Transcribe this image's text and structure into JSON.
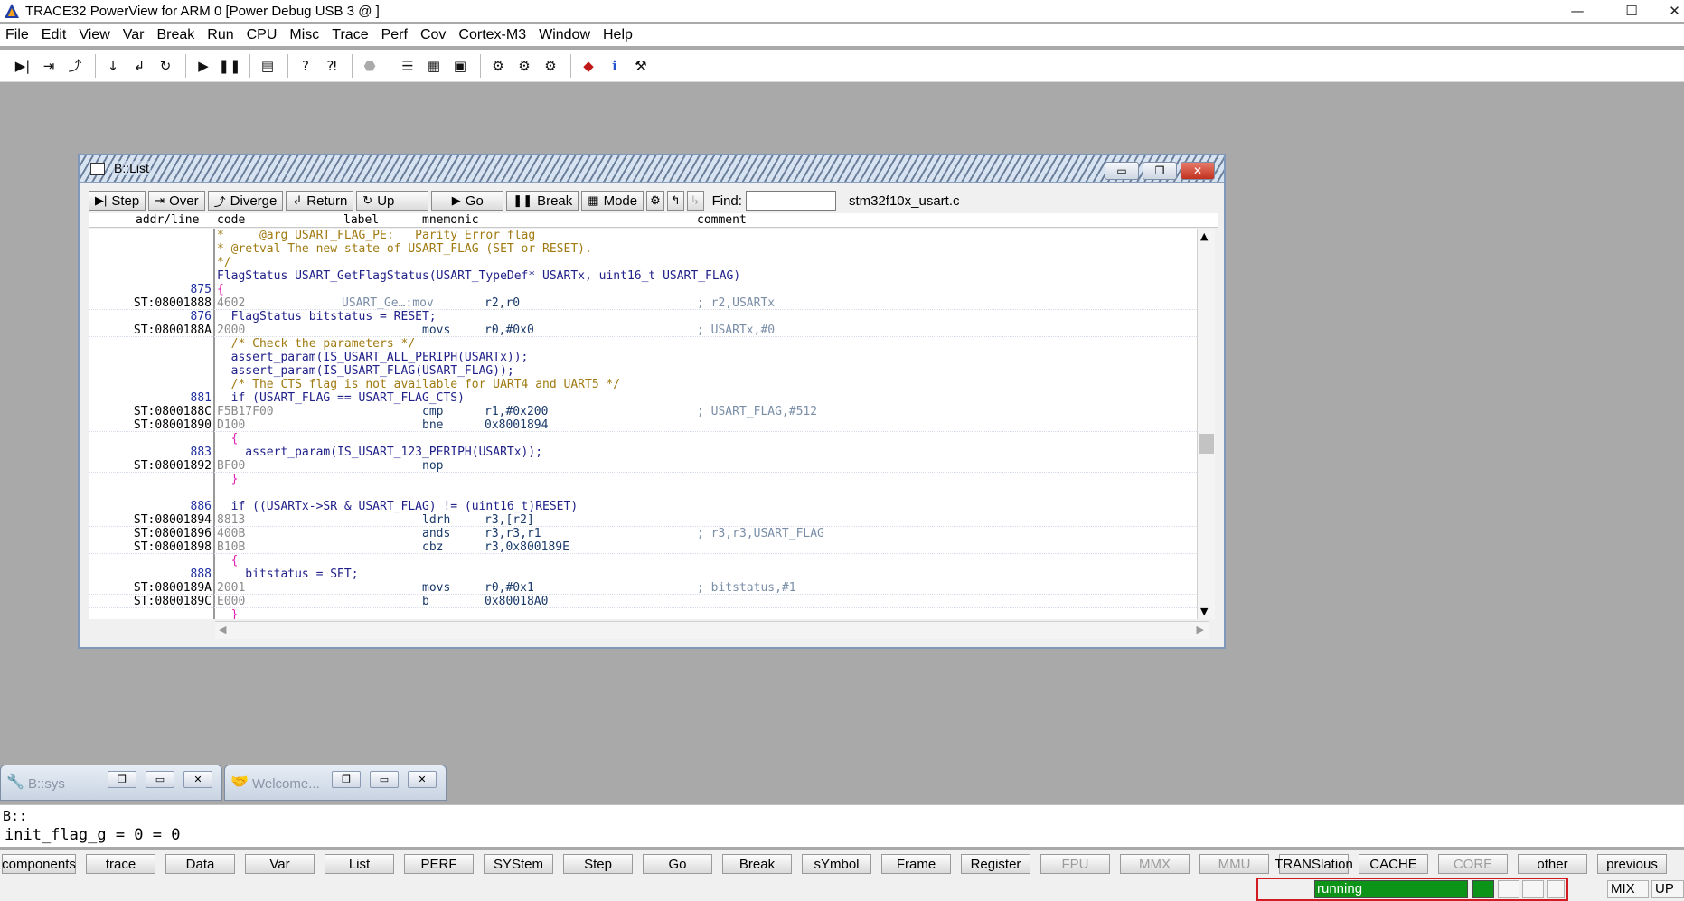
{
  "app": {
    "title": "TRACE32 PowerView for ARM 0 [Power Debug USB 3 @ ]",
    "minimize": "—",
    "maximize": "☐",
    "close": "✕"
  },
  "menu": [
    "File",
    "Edit",
    "View",
    "Var",
    "Break",
    "Run",
    "CPU",
    "Misc",
    "Trace",
    "Perf",
    "Cov",
    "Cortex-M3",
    "Window",
    "Help"
  ],
  "toolbar_icons": [
    "step-icon",
    "step-over-icon",
    "diverge-icon",
    "down-icon",
    "return-icon",
    "up-icon",
    "go-icon",
    "break-icon",
    "list-icon",
    "help-icon",
    "context-help-icon",
    "stop-icon",
    "list-view-icon",
    "dump-icon",
    "chip-icon",
    "trace-icon",
    "perf-icon",
    "cov-icon",
    "cube-icon",
    "info-icon",
    "config-icon"
  ],
  "blist": {
    "title": "B::List",
    "tools": {
      "step": "Step",
      "over": "Over",
      "diverge": "Diverge",
      "return": "Return",
      "up": "Up",
      "go": "Go",
      "break": "Break",
      "mode": "Mode",
      "find_label": "Find:",
      "file": "stm32f10x_usart.c"
    },
    "headers": {
      "addr": "addr/line",
      "code": "code",
      "label": "label",
      "mnemonic": "mnemonic",
      "comment": "comment"
    },
    "rows": [
      {
        "kind": "src",
        "addr": "",
        "text": "*     @arg USART_FLAG_PE:   Parity Error flag",
        "style": "comment"
      },
      {
        "kind": "src",
        "addr": "",
        "text": "* @retval The new state of USART_FLAG (SET or RESET).",
        "style": "comment"
      },
      {
        "kind": "src",
        "addr": "",
        "text": "*/",
        "style": "comment"
      },
      {
        "kind": "src",
        "addr": "",
        "text": "FlagStatus USART_GetFlagStatus(USART_TypeDef* USARTx, uint16_t USART_FLAG)",
        "style": "stmt"
      },
      {
        "kind": "src",
        "addr": "875",
        "text": "{",
        "style": "brace"
      },
      {
        "kind": "asm",
        "addr": "ST:08001888",
        "code": "4602",
        "label": "USART_Ge…:mov",
        "mnem": "",
        "ops": "r2,r0",
        "cmt": "; r2,USARTx"
      },
      {
        "kind": "src",
        "addr": "876",
        "text": "  FlagStatus bitstatus = RESET;",
        "style": "stmt"
      },
      {
        "kind": "asm",
        "addr": "ST:0800188A",
        "code": "2000",
        "label": "",
        "mnem": "movs",
        "ops": "r0,#0x0",
        "cmt": "; USARTx,#0"
      },
      {
        "kind": "src",
        "addr": "",
        "text": "  /* Check the parameters */",
        "style": "comment"
      },
      {
        "kind": "src",
        "addr": "",
        "text": "  assert_param(IS_USART_ALL_PERIPH(USARTx));",
        "style": "stmt"
      },
      {
        "kind": "src",
        "addr": "",
        "text": "  assert_param(IS_USART_FLAG(USART_FLAG));",
        "style": "stmt"
      },
      {
        "kind": "src",
        "addr": "",
        "text": "  /* The CTS flag is not available for UART4 and UART5 */",
        "style": "comment"
      },
      {
        "kind": "src",
        "addr": "881",
        "text": "  if (USART_FLAG == USART_FLAG_CTS)",
        "style": "stmt"
      },
      {
        "kind": "asm",
        "addr": "ST:0800188C",
        "code": "F5B17F00",
        "label": "",
        "mnem": "cmp",
        "ops": "r1,#0x200",
        "cmt": "; USART_FLAG,#512"
      },
      {
        "kind": "asm",
        "addr": "ST:08001890",
        "code": "D100",
        "label": "",
        "mnem": "bne",
        "ops": "0x8001894",
        "cmt": ""
      },
      {
        "kind": "src",
        "addr": "",
        "text": "  {",
        "style": "brace"
      },
      {
        "kind": "src",
        "addr": "883",
        "text": "    assert_param(IS_USART_123_PERIPH(USARTx));",
        "style": "stmt"
      },
      {
        "kind": "asm",
        "addr": "ST:08001892",
        "code": "BF00",
        "label": "",
        "mnem": "nop",
        "ops": "",
        "cmt": ""
      },
      {
        "kind": "src",
        "addr": "",
        "text": "  }",
        "style": "brace"
      },
      {
        "kind": "src",
        "addr": "",
        "text": "",
        "style": "stmt"
      },
      {
        "kind": "src",
        "addr": "886",
        "text": "  if ((USARTx->SR & USART_FLAG) != (uint16_t)RESET)",
        "style": "stmt"
      },
      {
        "kind": "asm",
        "addr": "ST:08001894",
        "code": "8813",
        "label": "",
        "mnem": "ldrh",
        "ops": "r3,[r2]",
        "cmt": ""
      },
      {
        "kind": "asm",
        "addr": "ST:08001896",
        "code": "400B",
        "label": "",
        "mnem": "ands",
        "ops": "r3,r3,r1",
        "cmt": "; r3,r3,USART_FLAG"
      },
      {
        "kind": "asm",
        "addr": "ST:08001898",
        "code": "B10B",
        "label": "",
        "mnem": "cbz",
        "ops": "r3,0x800189E",
        "cmt": ""
      },
      {
        "kind": "src",
        "addr": "",
        "text": "  {",
        "style": "brace"
      },
      {
        "kind": "src",
        "addr": "888",
        "text": "    bitstatus = SET;",
        "style": "stmt"
      },
      {
        "kind": "asm",
        "addr": "ST:0800189A",
        "code": "2001",
        "label": "",
        "mnem": "movs",
        "ops": "r0,#0x1",
        "cmt": "; bitstatus,#1"
      },
      {
        "kind": "asm",
        "addr": "ST:0800189C",
        "code": "E000",
        "label": "",
        "mnem": "b",
        "ops": "0x80018A0",
        "cmt": ""
      },
      {
        "kind": "src",
        "addr": "",
        "text": "  }",
        "style": "brace"
      }
    ]
  },
  "minimized": [
    {
      "label": "B::sys"
    },
    {
      "label": "Welcome..."
    }
  ],
  "command": {
    "prompt": "B::",
    "result": "init_flag_g = 0 = 0"
  },
  "buttons": [
    {
      "label": "components",
      "disabled": false,
      "w": 80
    },
    {
      "label": "trace",
      "disabled": false,
      "w": 76
    },
    {
      "label": "Data",
      "disabled": false,
      "w": 76
    },
    {
      "label": "Var",
      "disabled": false,
      "w": 76
    },
    {
      "label": "List",
      "disabled": false,
      "w": 76
    },
    {
      "label": "PERF",
      "disabled": false,
      "w": 76
    },
    {
      "label": "SYStem",
      "disabled": false,
      "w": 76
    },
    {
      "label": "Step",
      "disabled": false,
      "w": 76
    },
    {
      "label": "Go",
      "disabled": false,
      "w": 76
    },
    {
      "label": "Break",
      "disabled": false,
      "w": 76
    },
    {
      "label": "sYmbol",
      "disabled": false,
      "w": 76
    },
    {
      "label": "Frame",
      "disabled": false,
      "w": 76
    },
    {
      "label": "Register",
      "disabled": false,
      "w": 76
    },
    {
      "label": "FPU",
      "disabled": true,
      "w": 76
    },
    {
      "label": "MMX",
      "disabled": true,
      "w": 76
    },
    {
      "label": "MMU",
      "disabled": true,
      "w": 76
    },
    {
      "label": "TRANSlation",
      "disabled": false,
      "w": 76
    },
    {
      "label": "CACHE",
      "disabled": false,
      "w": 76
    },
    {
      "label": "CORE",
      "disabled": true,
      "w": 76
    },
    {
      "label": "other",
      "disabled": false,
      "w": 76
    },
    {
      "label": "previous",
      "disabled": false,
      "w": 76
    }
  ],
  "status": {
    "state": "running",
    "mode": "MIX",
    "dir": "UP",
    "running_color": "#0b9418",
    "highlight_color": "#d21c24"
  }
}
